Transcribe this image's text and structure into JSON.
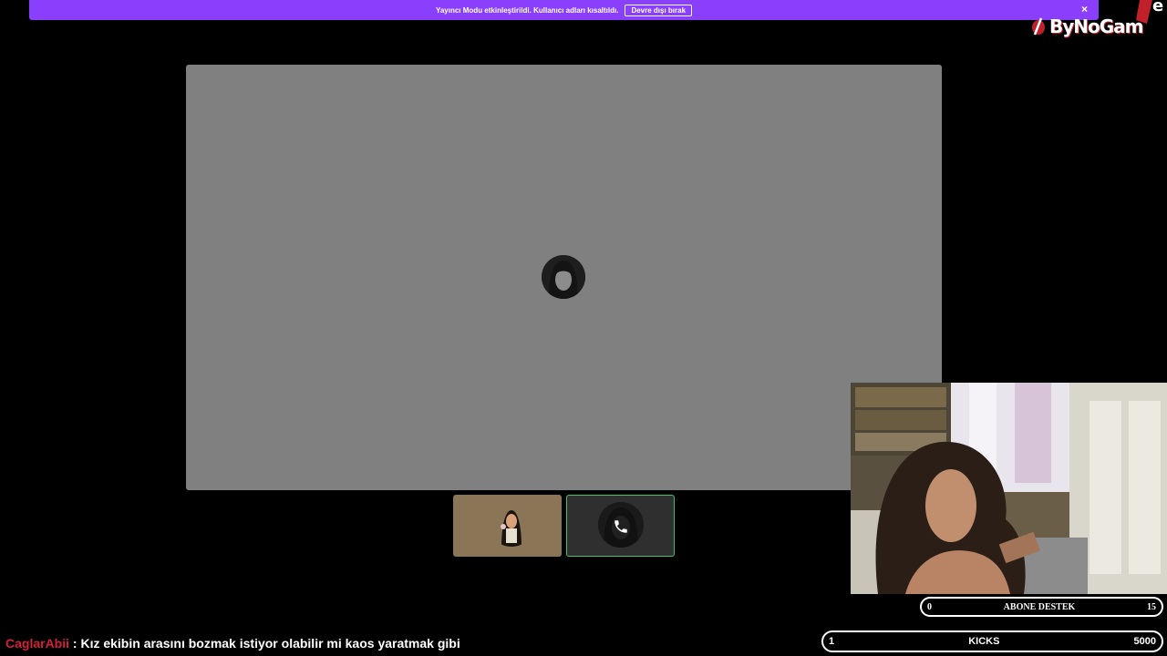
{
  "banner": {
    "message": "Yayıncı Modu etkinleştirildi. Kullanıcı adları kısaltıldı.",
    "disable_label": "Devre dışı bırak",
    "close_label": "×"
  },
  "logo": {
    "text": "ByNoGam",
    "corner_letter": "e"
  },
  "stats": {
    "abone": {
      "left": "0",
      "label": "ABONE DESTEK",
      "right": "15"
    },
    "kicks": {
      "left": "1",
      "label": "KICKS",
      "right": "5000"
    }
  },
  "chat": {
    "user": "CaglarAbii",
    "message": " : Kız ekibin arasını bozmak istiyor olabilir mi kaos yaratmak gibi"
  },
  "colors": {
    "banner": "#8a3ffc",
    "stage": "#808080",
    "speaking_border": "#3ec46d",
    "chat_user": "#d4203a"
  },
  "icons": {
    "close": "close-icon",
    "phone": "phone-icon",
    "logo": "bynogam-logo"
  }
}
